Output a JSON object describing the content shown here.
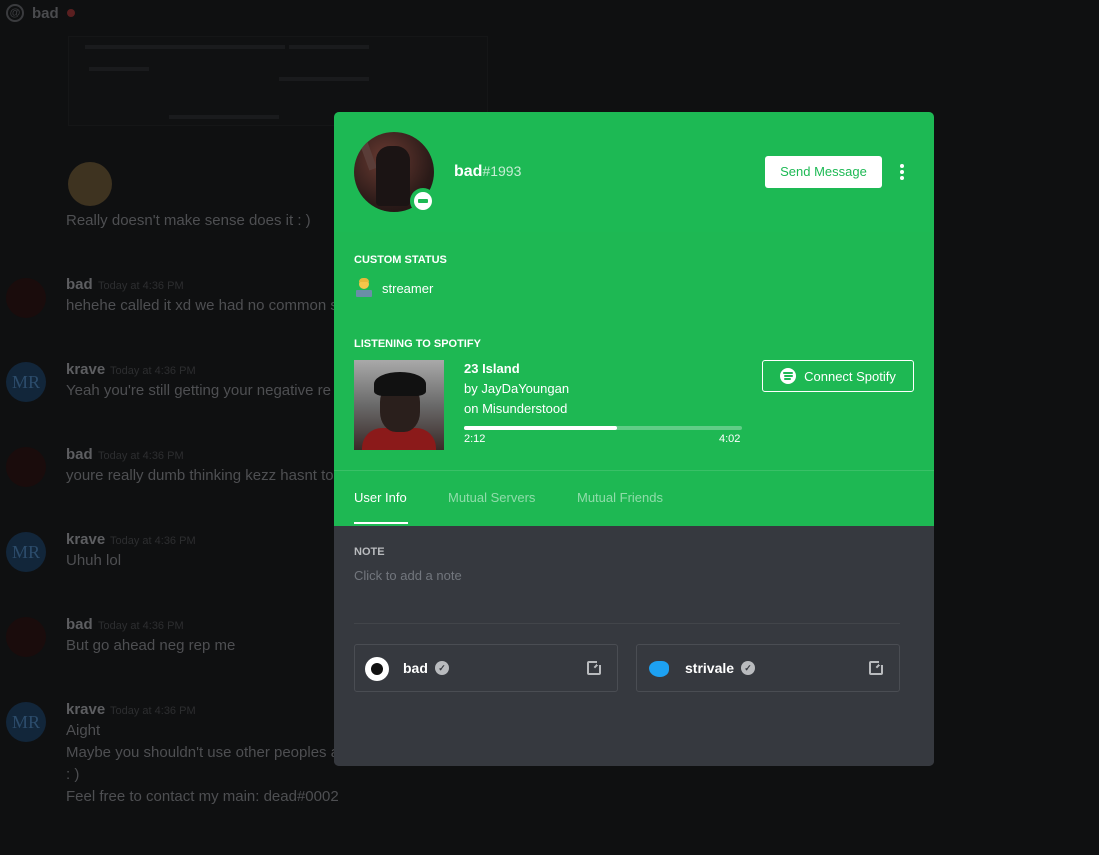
{
  "background": {
    "channel_name": "bad",
    "messages": [
      {
        "author": "",
        "time": "",
        "text": "Really doesn't make sense does it : )",
        "avatar": "thinking-emoji"
      },
      {
        "author": "bad",
        "time": "Today at 4:36 PM",
        "text": "hehehe called it xd we had no common s",
        "avatar": "bad"
      },
      {
        "author": "krave",
        "time": "Today at 4:36 PM",
        "text": "Yeah you're still getting your negative re",
        "avatar": "MR"
      },
      {
        "author": "bad",
        "time": "Today at 4:36 PM",
        "text": "youre really dumb thinking kezz hasnt to",
        "avatar": "bad"
      },
      {
        "author": "krave",
        "time": "Today at 4:36 PM",
        "text": "Uhuh lol",
        "avatar": "MR"
      },
      {
        "author": "bad",
        "time": "Today at 4:36 PM",
        "text": "But go ahead neg rep me",
        "avatar": "bad"
      },
      {
        "author": "krave",
        "time": "Today at 4:36 PM",
        "text": "Aight",
        "avatar": "MR"
      }
    ],
    "extra_lines": [
      "Maybe you shouldn't use other peoples a",
      ": )",
      "Feel free to contact my main: dead#0002"
    ]
  },
  "profile": {
    "username": "bad",
    "discriminator": "#1993",
    "send_message_label": "Send Message",
    "custom_status_label": "CUSTOM STATUS",
    "custom_status_text": "streamer",
    "listening_label": "LISTENING TO SPOTIFY",
    "track_title": "23 Island",
    "track_artist": "by JayDaYoungan",
    "track_album": "on Misunderstood",
    "elapsed": "2:12",
    "duration": "4:02",
    "progress": 0.55,
    "connect_spotify_label": "Connect Spotify",
    "tabs": [
      "User Info",
      "Mutual Servers",
      "Mutual Friends"
    ],
    "active_tab": "User Info",
    "note_label": "NOTE",
    "note_placeholder": "Click to add a note",
    "accounts": [
      {
        "service": "steam",
        "name": "bad"
      },
      {
        "service": "twitter",
        "name": "strivale"
      }
    ]
  },
  "colors": {
    "spotify_green": "#1db954",
    "modal_body": "#36393f"
  }
}
